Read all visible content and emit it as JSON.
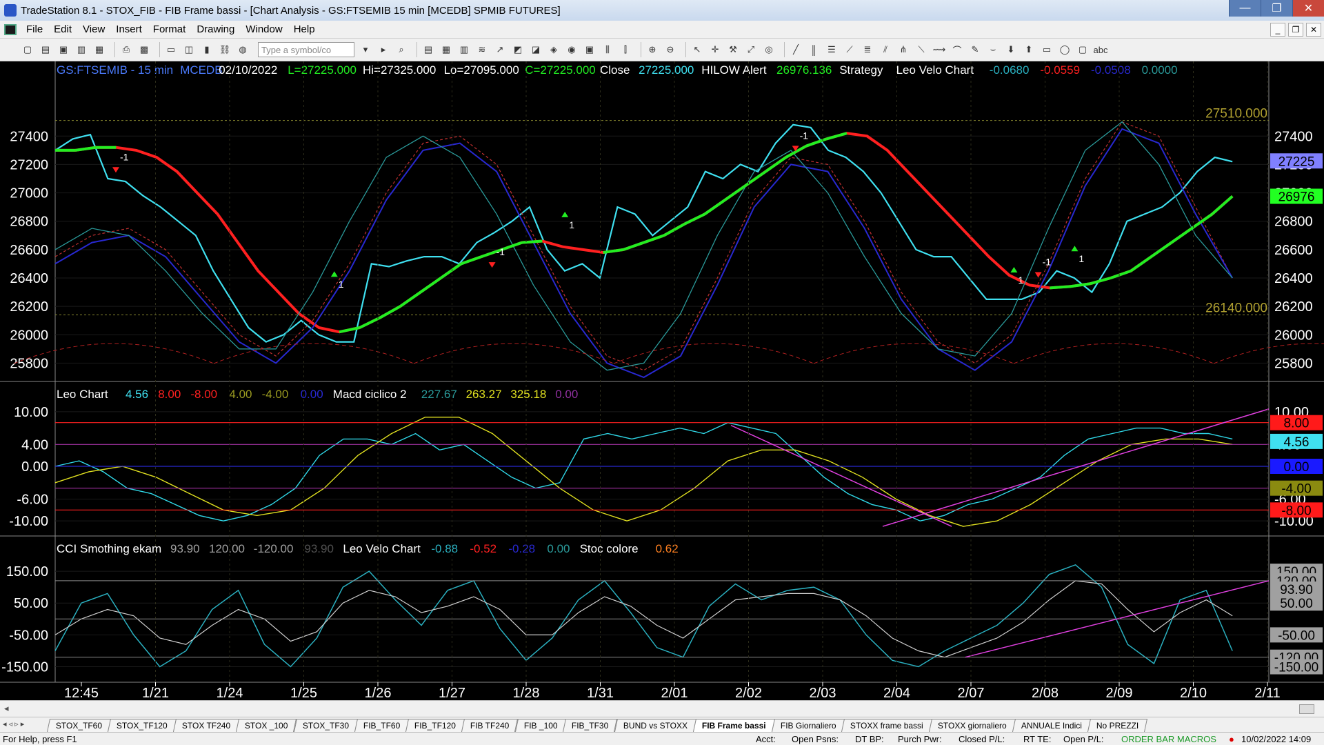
{
  "window": {
    "title": "TradeStation 8.1 - STOX_FIB - FIB Frame bassi - [Chart Analysis - GS:FTSEMIB 15 min  [MCEDB] SPMIB FUTURES]",
    "minimize": "—",
    "maximize": "❐",
    "close": "✕"
  },
  "menu": {
    "items": [
      "File",
      "Edit",
      "View",
      "Insert",
      "Format",
      "Drawing",
      "Window",
      "Help"
    ]
  },
  "toolbar": {
    "symbol_placeholder": "Type a symbol/co"
  },
  "chart_data": [
    {
      "type": "line",
      "panel": "price",
      "header": {
        "symbol": "GS:FTSEMIB - 15 min",
        "feed": "MCEDB",
        "date": "02/10/2022",
        "last": "L=27225.000",
        "high": "Hi=27325.000",
        "low": "Lo=27095.000",
        "close_eq": "C=27225.000",
        "close_label": "Close",
        "close_val": "27225.000",
        "hilow_label": "HILOW Alert",
        "hilow_val": "26976.136",
        "strategy_label": "Strategy",
        "leo_label": "Leo Velo Chart",
        "leo_vals": [
          "-0.0680",
          "-0.0559",
          "-0.0508",
          "0.0000"
        ]
      },
      "y_ticks": [
        "27400",
        "27200",
        "27000",
        "26800",
        "26600",
        "26400",
        "26200",
        "26000",
        "25800"
      ],
      "ylim": [
        25700,
        27800
      ],
      "level_labels": [
        "27510.000",
        "26140.000"
      ],
      "levels": [
        27510,
        26140
      ],
      "right_badges": [
        {
          "text": "27225",
          "value": 27225,
          "color": "#8080ff"
        },
        {
          "text": "26976",
          "value": 26976,
          "color": "#22ff22"
        }
      ],
      "signals": [
        {
          "text": "-1",
          "x": 0.05,
          "y": 27230,
          "dir": "down"
        },
        {
          "text": "1",
          "x": 0.23,
          "y": 26360,
          "dir": "up"
        },
        {
          "text": "-1",
          "x": 0.36,
          "y": 26560,
          "dir": "down"
        },
        {
          "text": "1",
          "x": 0.42,
          "y": 26780,
          "dir": "up"
        },
        {
          "text": "-1",
          "x": 0.61,
          "y": 27380,
          "dir": "down"
        },
        {
          "text": "1",
          "x": 0.79,
          "y": 26390,
          "dir": "up"
        },
        {
          "text": "-1",
          "x": 0.81,
          "y": 26490,
          "dir": "down"
        },
        {
          "text": "1",
          "x": 0.84,
          "y": 26540,
          "dir": "up"
        }
      ],
      "series": [
        {
          "name": "price",
          "values": [
            27300,
            27380,
            27410,
            27100,
            27080,
            26980,
            26900,
            26800,
            26700,
            26450,
            26250,
            26050,
            25950,
            26000,
            26100,
            26000,
            25950,
            25950,
            26500,
            26480,
            26520,
            26550,
            26550,
            26500,
            26650,
            26720,
            26800,
            26900,
            26600,
            26450,
            26500,
            26400,
            26900,
            26850,
            26700,
            26800,
            26900,
            27150,
            27100,
            27200,
            27150,
            27350,
            27480,
            27460,
            27300,
            27250,
            27150,
            27000,
            26800,
            26600,
            26550,
            26550,
            26400,
            26250,
            26250,
            26250,
            26300,
            26450,
            26400,
            26300,
            26500,
            26800,
            26850,
            26900,
            27000,
            27150,
            27250,
            27220
          ]
        },
        {
          "name": "strategy",
          "values": [
            27300,
            27300,
            27320,
            27320,
            27300,
            27250,
            27150,
            27000,
            26850,
            26650,
            26450,
            26300,
            26150,
            26050,
            26020,
            26050,
            26120,
            26200,
            26300,
            26400,
            26500,
            26550,
            26600,
            26650,
            26660,
            26620,
            26600,
            26580,
            26600,
            26650,
            26700,
            26780,
            26850,
            26950,
            27050,
            27150,
            27250,
            27330,
            27380,
            27420,
            27400,
            27300,
            27150,
            27000,
            26850,
            26700,
            26550,
            26420,
            26350,
            26330,
            26340,
            26360,
            26400,
            26450,
            26550,
            26650,
            26750,
            26850,
            26976
          ]
        },
        {
          "name": "cycle-red",
          "values": [
            26550,
            26700,
            26750,
            26600,
            26300,
            26000,
            25850,
            26100,
            26500,
            27000,
            27350,
            27400,
            27200,
            26700,
            26200,
            25850,
            25750,
            25900,
            26400,
            26950,
            27250,
            27200,
            26800,
            26300,
            25950,
            25800,
            26000,
            26500,
            27100,
            27500,
            27400,
            26900,
            26400
          ]
        },
        {
          "name": "cycle-blue",
          "values": [
            26500,
            26650,
            26700,
            26550,
            26250,
            25950,
            25800,
            26050,
            26450,
            26950,
            27300,
            27350,
            27150,
            26650,
            26150,
            25800,
            25700,
            25850,
            26350,
            26900,
            27200,
            27150,
            26750,
            26250,
            25900,
            25750,
            25950,
            26450,
            27050,
            27450,
            27350,
            26850,
            26400
          ]
        },
        {
          "name": "cycle-teal",
          "values": [
            26600,
            26750,
            26700,
            26450,
            26150,
            25900,
            25900,
            26300,
            26800,
            27250,
            27400,
            27250,
            26850,
            26350,
            25950,
            25750,
            25800,
            26150,
            26700,
            27150,
            27300,
            27000,
            26550,
            26150,
            25900,
            25850,
            26150,
            26750,
            27300,
            27500,
            27200,
            26700,
            26400
          ]
        }
      ]
    },
    {
      "type": "line",
      "panel": "leo-macd",
      "header": {
        "label": "Leo Chart",
        "vals": [
          "4.56",
          "8.00",
          "-8.00",
          "4.00",
          "-4.00",
          "0.00"
        ],
        "macd_label": "Macd ciclico 2",
        "macd_vals": [
          "227.67",
          "263.27",
          "325.18",
          "0.00"
        ]
      },
      "y_ticks": [
        "10.00",
        "4.00",
        "0.00",
        "-6.00",
        "-10.00"
      ],
      "ylim": [
        -12,
        12
      ],
      "right_badges": [
        {
          "text": "8.00",
          "value": 8,
          "color": "#ff1a1a"
        },
        {
          "text": "4.56",
          "value": 4.56,
          "color": "#40e0f0"
        },
        {
          "text": "0.00",
          "value": 0,
          "color": "#1a1aff"
        },
        {
          "text": "-4.00",
          "value": -4,
          "color": "#8a8a10"
        },
        {
          "text": "-8.00",
          "value": -8,
          "color": "#ff1a1a"
        }
      ],
      "series": [
        {
          "name": "leo",
          "values": [
            0,
            1,
            -1,
            -4,
            -5,
            -7,
            -9,
            -10,
            -9,
            -7,
            -4,
            2,
            5,
            5,
            4,
            6,
            3,
            4,
            1,
            -2,
            -4,
            -3,
            5,
            6,
            5,
            6,
            7,
            6,
            8,
            7,
            6,
            2,
            -2,
            -5,
            -7,
            -8,
            -10,
            -9,
            -7,
            -6,
            -4,
            -2,
            2,
            5,
            6,
            7,
            7,
            6,
            6,
            5
          ]
        },
        {
          "name": "macd-yellow",
          "values": [
            -3,
            -1,
            0,
            -2,
            -5,
            -8,
            -9,
            -8,
            -4,
            2,
            6,
            9,
            9,
            6,
            1,
            -4,
            -8,
            -10,
            -8,
            -4,
            1,
            3,
            3,
            1,
            -2,
            -6,
            -9,
            -11,
            -10,
            -7,
            -3,
            1,
            4,
            5,
            5,
            4
          ]
        }
      ]
    },
    {
      "type": "line",
      "panel": "cci",
      "header": {
        "label": "CCI Smothing ekam",
        "vals": [
          "93.90",
          "120.00",
          "-120.00",
          "93.90"
        ],
        "leo_label": "Leo Velo Chart",
        "leo_vals": [
          "-0.88",
          "-0.52",
          "-0.28",
          "0.00"
        ],
        "stoc_label": "Stoc colore",
        "stoc_val": "0.62"
      },
      "y_ticks": [
        "150.00",
        "50.00",
        "-50.00",
        "-150.00"
      ],
      "ylim": [
        -190,
        200
      ],
      "right_badges": [
        {
          "text": "150.00",
          "value": 150,
          "color": "#a0a0a0"
        },
        {
          "text": "120.00",
          "value": 120,
          "color": "#a0a0a0"
        },
        {
          "text": "93.90",
          "value": 93.9,
          "color": "#a0a0a0"
        },
        {
          "text": "50.00",
          "value": 50,
          "color": "#a0a0a0"
        },
        {
          "text": "-50.00",
          "value": -50,
          "color": "#a0a0a0"
        },
        {
          "text": "-120.00",
          "value": -120,
          "color": "#a0a0a0"
        },
        {
          "text": "-150.00",
          "value": -150,
          "color": "#a0a0a0"
        }
      ],
      "series": [
        {
          "name": "cci",
          "values": [
            -100,
            50,
            80,
            -50,
            -150,
            -100,
            30,
            90,
            -80,
            -150,
            -60,
            100,
            150,
            60,
            -20,
            90,
            120,
            -30,
            -130,
            -60,
            60,
            120,
            20,
            -90,
            -120,
            40,
            110,
            60,
            90,
            100,
            60,
            -50,
            -130,
            -150,
            -100,
            -60,
            -20,
            50,
            140,
            170,
            100,
            -80,
            -140,
            60,
            90,
            -100
          ]
        },
        {
          "name": "white",
          "values": [
            -50,
            0,
            30,
            10,
            -60,
            -80,
            -20,
            30,
            0,
            -70,
            -40,
            50,
            90,
            70,
            20,
            40,
            70,
            30,
            -50,
            -50,
            20,
            70,
            40,
            -20,
            -60,
            0,
            60,
            70,
            80,
            80,
            60,
            10,
            -60,
            -100,
            -120,
            -90,
            -60,
            -10,
            60,
            120,
            110,
            30,
            -40,
            20,
            60,
            10
          ]
        }
      ]
    }
  ],
  "x_ticks": [
    "12:45",
    "1/21",
    "1/24",
    "1/25",
    "1/26",
    "1/27",
    "1/28",
    "1/31",
    "2/01",
    "2/02",
    "2/03",
    "2/04",
    "2/07",
    "2/08",
    "2/09",
    "2/10",
    "2/11"
  ],
  "tabs": [
    "STOX_TF60",
    "STOX_TF120",
    "STOX TF240",
    "STOX _100",
    "STOX_TF30",
    "FIB_TF60",
    "FIB_TF120",
    "FIB TF240",
    "FIB _100",
    "FIB_TF30",
    "BUND vs STOXX",
    "FIB Frame bassi",
    "FIB Giornaliero",
    "STOXX frame bassi",
    "STOXX giornaliero",
    "ANNUALE Indici",
    "No PREZZI"
  ],
  "active_tab": "FIB Frame bassi",
  "status": {
    "help": "For Help, press F1",
    "acct": "Acct:",
    "open_psns": "Open Psns:",
    "dt_bp": "DT BP:",
    "purch_pwr": "Purch Pwr:",
    "closed_pl": "Closed P/L:",
    "rt_te": "RT TE:",
    "open_pl": "Open P/L:",
    "macros": "ORDER BAR  MACROS",
    "datetime": "10/02/2022 14:09"
  }
}
